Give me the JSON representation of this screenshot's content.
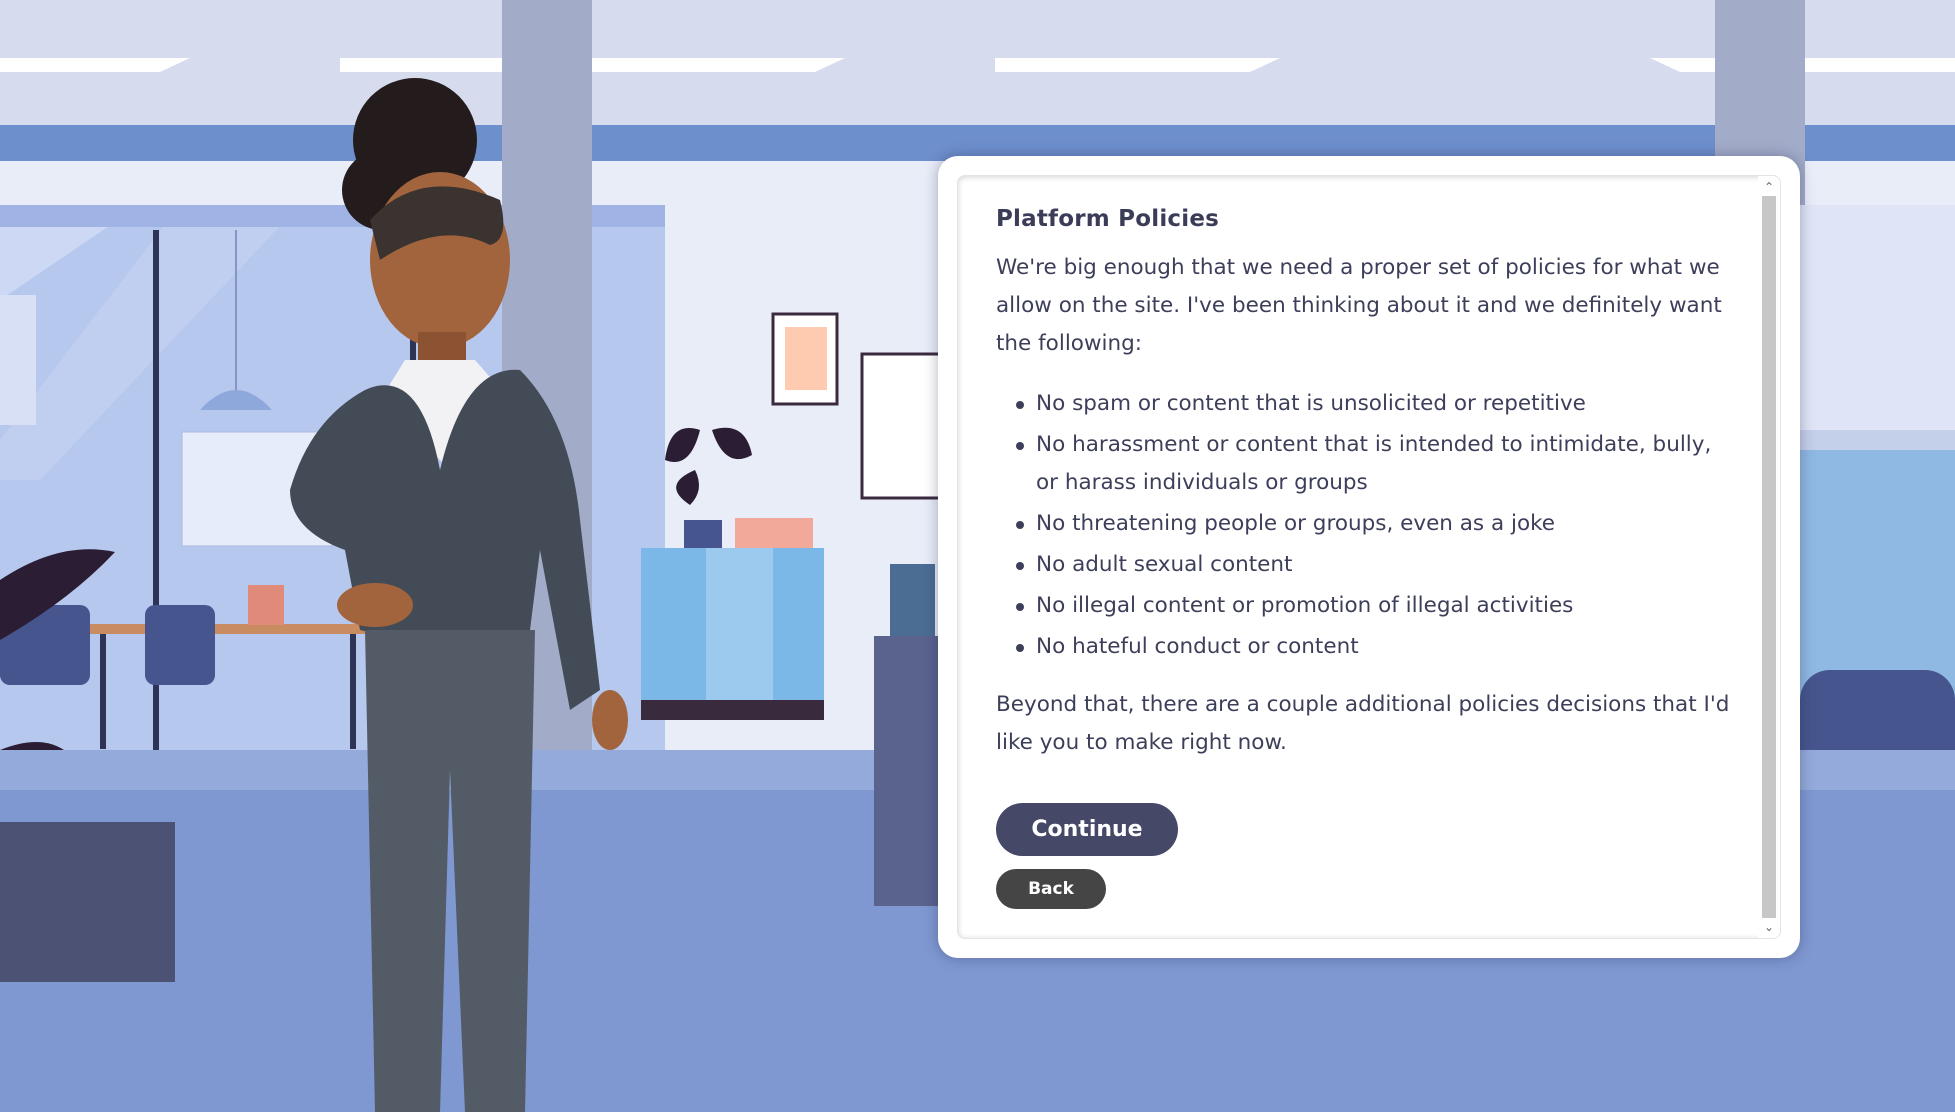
{
  "colors": {
    "primary_button": "#454866",
    "secondary_button": "#454545",
    "text": "#3d3f5a",
    "background": "#c9d3ea"
  },
  "dialog": {
    "title": "Platform Policies",
    "intro": "We're big enough that we need a proper set of policies for what we allow on the site. I've been thinking about it and we definitely want the following:",
    "policies": [
      "No spam or content that is unsolicited or repetitive",
      "No harassment or content that is intended to intimidate, bully, or harass individuals or groups",
      "No threatening people or groups, even as a joke",
      "No adult sexual content",
      "No illegal content or promotion of illegal activities",
      "No hateful conduct or content"
    ],
    "outro": "Beyond that, there are a couple additional policies decisions that I'd like you to make right now.",
    "continue_label": "Continue",
    "back_label": "Back",
    "scroll_up_icon": "chevron-up-icon",
    "scroll_down_icon": "chevron-down-icon"
  }
}
